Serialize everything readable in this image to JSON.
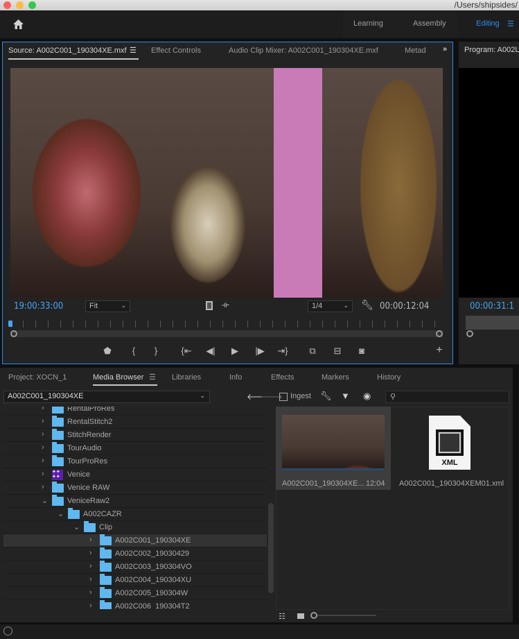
{
  "window": {
    "path": "/Users/shipsides/"
  },
  "header": {
    "home_icon": "home-icon",
    "workspaces": [
      {
        "label": "Learning"
      },
      {
        "label": "Assembly"
      },
      {
        "label": "Editing",
        "active": true
      }
    ],
    "accent": "#2d8ceb"
  },
  "source": {
    "tabs": [
      {
        "label": "Source: A002C001_190304XE.mxf"
      },
      {
        "label": "Effect Controls"
      },
      {
        "label": "Audio Clip Mixer: A002C001_190304XE.mxf"
      },
      {
        "label": "Metad"
      }
    ],
    "timecode_in": "19:00:33:00",
    "zoom": "Fit",
    "resolution": "1/4",
    "duration": "00:00:12:04"
  },
  "program": {
    "label": "Program: A002L",
    "timecode": "00:00:31:1"
  },
  "bottom": {
    "tabs": [
      {
        "label": "Project: XOCN_1"
      },
      {
        "label": "Media Browser"
      },
      {
        "label": "Libraries"
      },
      {
        "label": "Info"
      },
      {
        "label": "Effects"
      },
      {
        "label": "Markers"
      },
      {
        "label": "History"
      }
    ],
    "path_select": "A002C001_190304XE",
    "ingest_label": "Ingest",
    "search_placeholder": ""
  },
  "tree": [
    {
      "label": "RentalProRes",
      "level": 0,
      "expanded": false
    },
    {
      "label": "RentalStitch2",
      "level": 0,
      "expanded": false
    },
    {
      "label": "StitchRender",
      "level": 0,
      "expanded": false
    },
    {
      "label": "TourAudio",
      "level": 0,
      "expanded": false
    },
    {
      "label": "TourProRes",
      "level": 0,
      "expanded": false
    },
    {
      "label": "Venice",
      "level": 0,
      "expanded": false,
      "icon": "venice-special-icon"
    },
    {
      "label": "Venice RAW",
      "level": 0,
      "expanded": false
    },
    {
      "label": "VeniceRaw2",
      "level": 0,
      "expanded": true
    },
    {
      "label": "A002CAZR",
      "level": 1,
      "expanded": true
    },
    {
      "label": "Clip",
      "level": 2,
      "expanded": true
    },
    {
      "label": "A002C001_190304XE",
      "level": 3,
      "expanded": false,
      "selected": true
    },
    {
      "label": "A002C002_19030429",
      "level": 3,
      "expanded": false
    },
    {
      "label": "A002C003_190304VO",
      "level": 3,
      "expanded": false
    },
    {
      "label": "A002C004_190304XU",
      "level": 3,
      "expanded": false
    },
    {
      "label": "A002C005_190304W",
      "level": 3,
      "expanded": false
    },
    {
      "label": "A002C006_190304T2",
      "level": 3,
      "expanded": false
    }
  ],
  "files": [
    {
      "name": "A002C001_190304XE...",
      "duration": "12:04",
      "type": "video"
    },
    {
      "name": "A002C001_190304XEM01.xml",
      "type": "xml",
      "badge": "XML"
    }
  ]
}
